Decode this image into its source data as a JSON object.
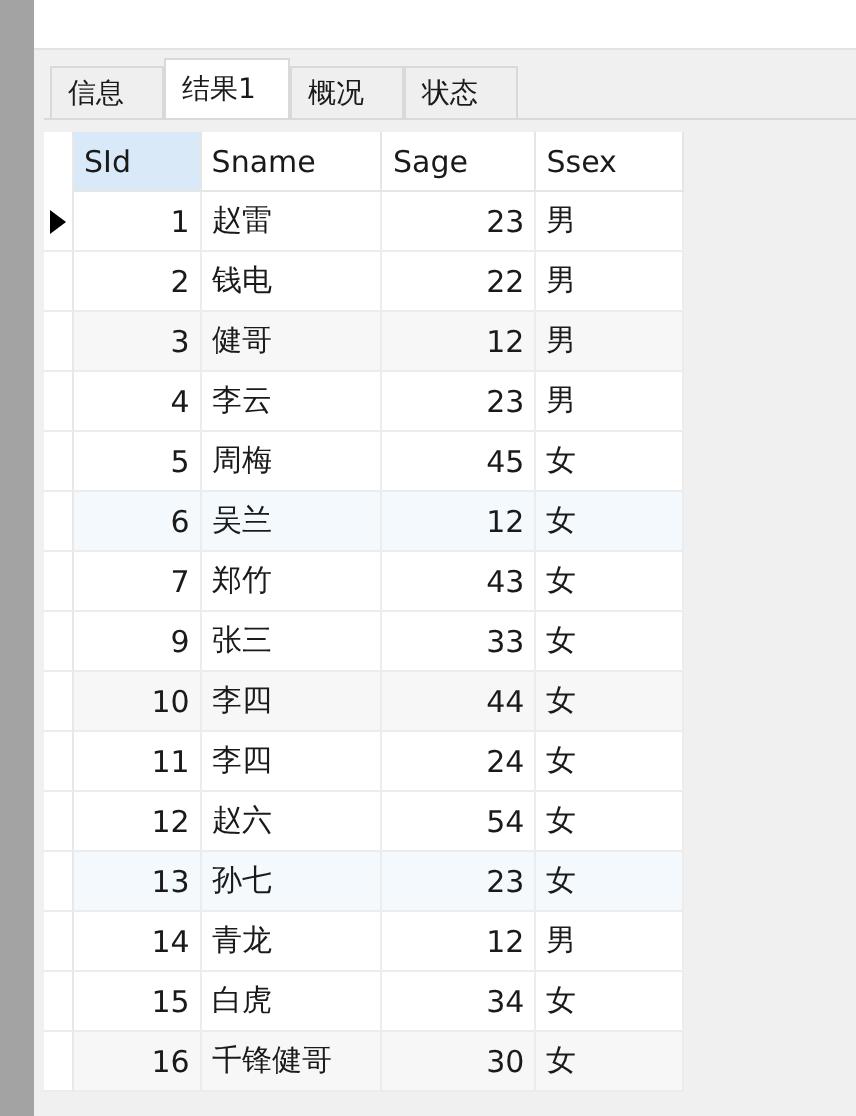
{
  "tabs": [
    {
      "label": "信息",
      "selected": false
    },
    {
      "label": "结果1",
      "selected": true
    },
    {
      "label": "概况",
      "selected": false
    },
    {
      "label": "状态",
      "selected": false
    }
  ],
  "table": {
    "columns": [
      {
        "label": "SId",
        "selected": true,
        "kind": "number"
      },
      {
        "label": "Sname",
        "selected": false,
        "kind": "text"
      },
      {
        "label": "Sage",
        "selected": false,
        "kind": "number"
      },
      {
        "label": "Ssex",
        "selected": false,
        "kind": "text"
      }
    ],
    "rows": [
      {
        "selected": true,
        "cells": [
          "1",
          "赵雷",
          "23",
          "男"
        ]
      },
      {
        "selected": false,
        "cells": [
          "2",
          "钱电",
          "22",
          "男"
        ]
      },
      {
        "selected": false,
        "cells": [
          "3",
          "健哥",
          "12",
          "男"
        ]
      },
      {
        "selected": false,
        "cells": [
          "4",
          "李云",
          "23",
          "男"
        ]
      },
      {
        "selected": false,
        "cells": [
          "5",
          "周梅",
          "45",
          "女"
        ]
      },
      {
        "selected": false,
        "cells": [
          "6",
          "吴兰",
          "12",
          "女"
        ]
      },
      {
        "selected": false,
        "cells": [
          "7",
          "郑竹",
          "43",
          "女"
        ]
      },
      {
        "selected": false,
        "cells": [
          "9",
          "张三",
          "33",
          "女"
        ]
      },
      {
        "selected": false,
        "cells": [
          "10",
          "李四",
          "44",
          "女"
        ]
      },
      {
        "selected": false,
        "cells": [
          "11",
          "李四",
          "24",
          "女"
        ]
      },
      {
        "selected": false,
        "cells": [
          "12",
          "赵六",
          "54",
          "女"
        ]
      },
      {
        "selected": false,
        "cells": [
          "13",
          "孙七",
          "23",
          "女"
        ]
      },
      {
        "selected": false,
        "cells": [
          "14",
          "青龙",
          "12",
          "男"
        ]
      },
      {
        "selected": false,
        "cells": [
          "15",
          "白虎",
          "34",
          "女"
        ]
      },
      {
        "selected": false,
        "cells": [
          "16",
          "千锋健哥",
          "30",
          "女"
        ]
      }
    ]
  }
}
